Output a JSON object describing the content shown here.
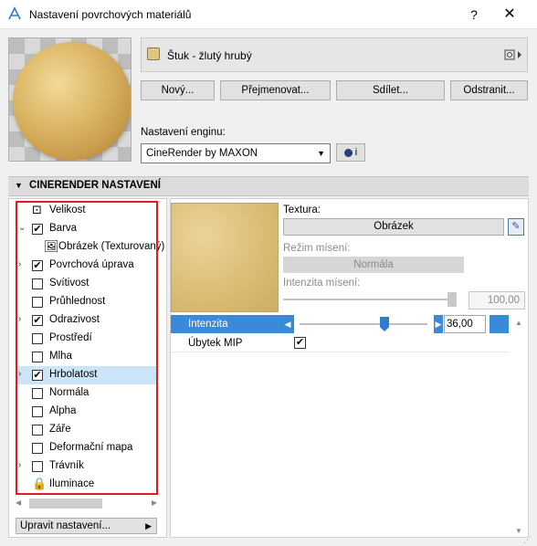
{
  "window": {
    "title": "Nastavení povrchových materiálů",
    "help_label": "?",
    "close_label": "✕"
  },
  "material": {
    "name": "Štuk - žlutý hrubý",
    "swatch_color": "#e1c583"
  },
  "buttons": {
    "new": "Nový...",
    "rename": "Přejmenovat...",
    "share": "Sdílet...",
    "remove": "Odstranit..."
  },
  "engine": {
    "label": "Nastavení enginu:",
    "value": "CineRender by MAXON",
    "info_label": "i"
  },
  "section": {
    "title": "CINERENDER NASTAVENÍ"
  },
  "tree": {
    "items": [
      {
        "label": "Velikost",
        "checked": null,
        "icon": "size-icon",
        "expander": ""
      },
      {
        "label": "Barva",
        "checked": true,
        "expander": "⌄"
      },
      {
        "label": "Obrázek (Texturovaný)",
        "checked": null,
        "icon": "image-icon",
        "expander": ""
      },
      {
        "label": "Povrchová úprava",
        "checked": true,
        "expander": "›"
      },
      {
        "label": "Svítivost",
        "checked": false,
        "expander": ""
      },
      {
        "label": "Průhlednost",
        "checked": false,
        "expander": ""
      },
      {
        "label": "Odrazivost",
        "checked": true,
        "expander": "›"
      },
      {
        "label": "Prostředí",
        "checked": false,
        "expander": ""
      },
      {
        "label": "Mlha",
        "checked": false,
        "expander": ""
      },
      {
        "label": "Hrbolatost",
        "checked": true,
        "expander": "›",
        "selected": true
      },
      {
        "label": "Normála",
        "checked": false,
        "expander": ""
      },
      {
        "label": "Alpha",
        "checked": false,
        "expander": ""
      },
      {
        "label": "Záře",
        "checked": false,
        "expander": ""
      },
      {
        "label": "Deformační mapa",
        "checked": false,
        "expander": ""
      },
      {
        "label": "Trávník",
        "checked": false,
        "expander": "›"
      },
      {
        "label": "Iluminace",
        "checked": null,
        "icon": "lock-icon",
        "expander": ""
      }
    ]
  },
  "adjust": {
    "label": "Upravit nastavení..."
  },
  "texture": {
    "label": "Textura:",
    "button": "Obrázek",
    "blend_mode_label": "Režim mísení:",
    "blend_mode_value": "Normála",
    "blend_intensity_label": "Intenzita mísení:",
    "blend_intensity_value": "100,00",
    "blend_intensity_level": 1.0
  },
  "params": {
    "intensity_label": "Intenzita",
    "intensity_value": "36,00",
    "intensity_level": 0.36,
    "mip_label": "Úbytek MIP",
    "mip_checked": true
  }
}
